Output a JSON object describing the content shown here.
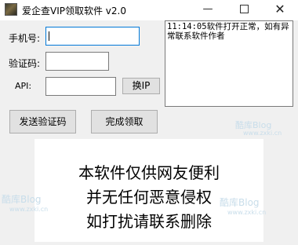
{
  "window": {
    "title": "爱企查VIP领取软件 v2.0",
    "minimize_glyph": "—",
    "close_glyph": "✕"
  },
  "form": {
    "phone_label": "手机号:",
    "phone_value": "",
    "code_label": "验证码:",
    "code_value": "",
    "api_label": "API:",
    "api_value": "",
    "switch_ip_label": "换IP"
  },
  "actions": {
    "send_code_label": "发送验证码",
    "claim_label": "完成领取"
  },
  "log": {
    "text": "11:14:05软件打开正常，如有异常联系软件作者"
  },
  "banner": {
    "lines": [
      "本软件仅供网友便利",
      "并无任何恶意侵权",
      "如打扰请联系删除"
    ]
  },
  "watermark": {
    "brand": "酷库Blog",
    "url": "www.zxki.cn"
  }
}
